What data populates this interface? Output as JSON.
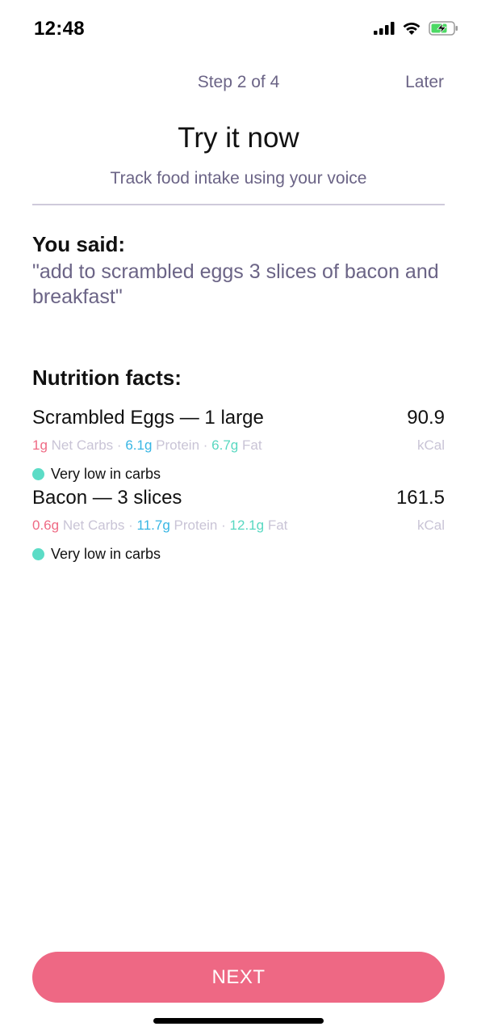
{
  "status_bar": {
    "time": "12:48",
    "icons": [
      "signal-icon",
      "wifi-icon",
      "battery-charging-icon"
    ]
  },
  "nav": {
    "step": "Step 2 of 4",
    "later_label": "Later"
  },
  "header": {
    "title": "Try it now",
    "subtitle": "Track food intake using your voice"
  },
  "you_said": {
    "heading": "You said:",
    "text": "\"add to scrambled eggs 3 slices of bacon and breakfast\""
  },
  "nutrition": {
    "heading": "Nutrition facts:",
    "items": [
      {
        "name": "Scrambled Eggs — 1 large",
        "calories": "90.9",
        "carbs_value": "1g",
        "carbs_label": "Net Carbs",
        "protein_value": "6.1g",
        "protein_label": "Protein",
        "fat_value": "6.7g",
        "fat_label": "Fat",
        "separator": "·",
        "unit": "kCal",
        "tag": "Very low in carbs"
      },
      {
        "name": "Bacon — 3 slices",
        "calories": "161.5",
        "carbs_value": "0.6g",
        "carbs_label": "Net Carbs",
        "protein_value": "11.7g",
        "protein_label": "Protein",
        "fat_value": "12.1g",
        "fat_label": "Fat",
        "separator": "·",
        "unit": "kCal",
        "tag": "Very low in carbs"
      }
    ]
  },
  "footer": {
    "next_label": "NEXT"
  },
  "colors": {
    "accent": "#ee6884",
    "carbs": "#ef6a84",
    "protein": "#38b6e4",
    "fat": "#58d8c1",
    "tag_dot": "#5cdcc6",
    "muted_text": "#6b6486"
  }
}
